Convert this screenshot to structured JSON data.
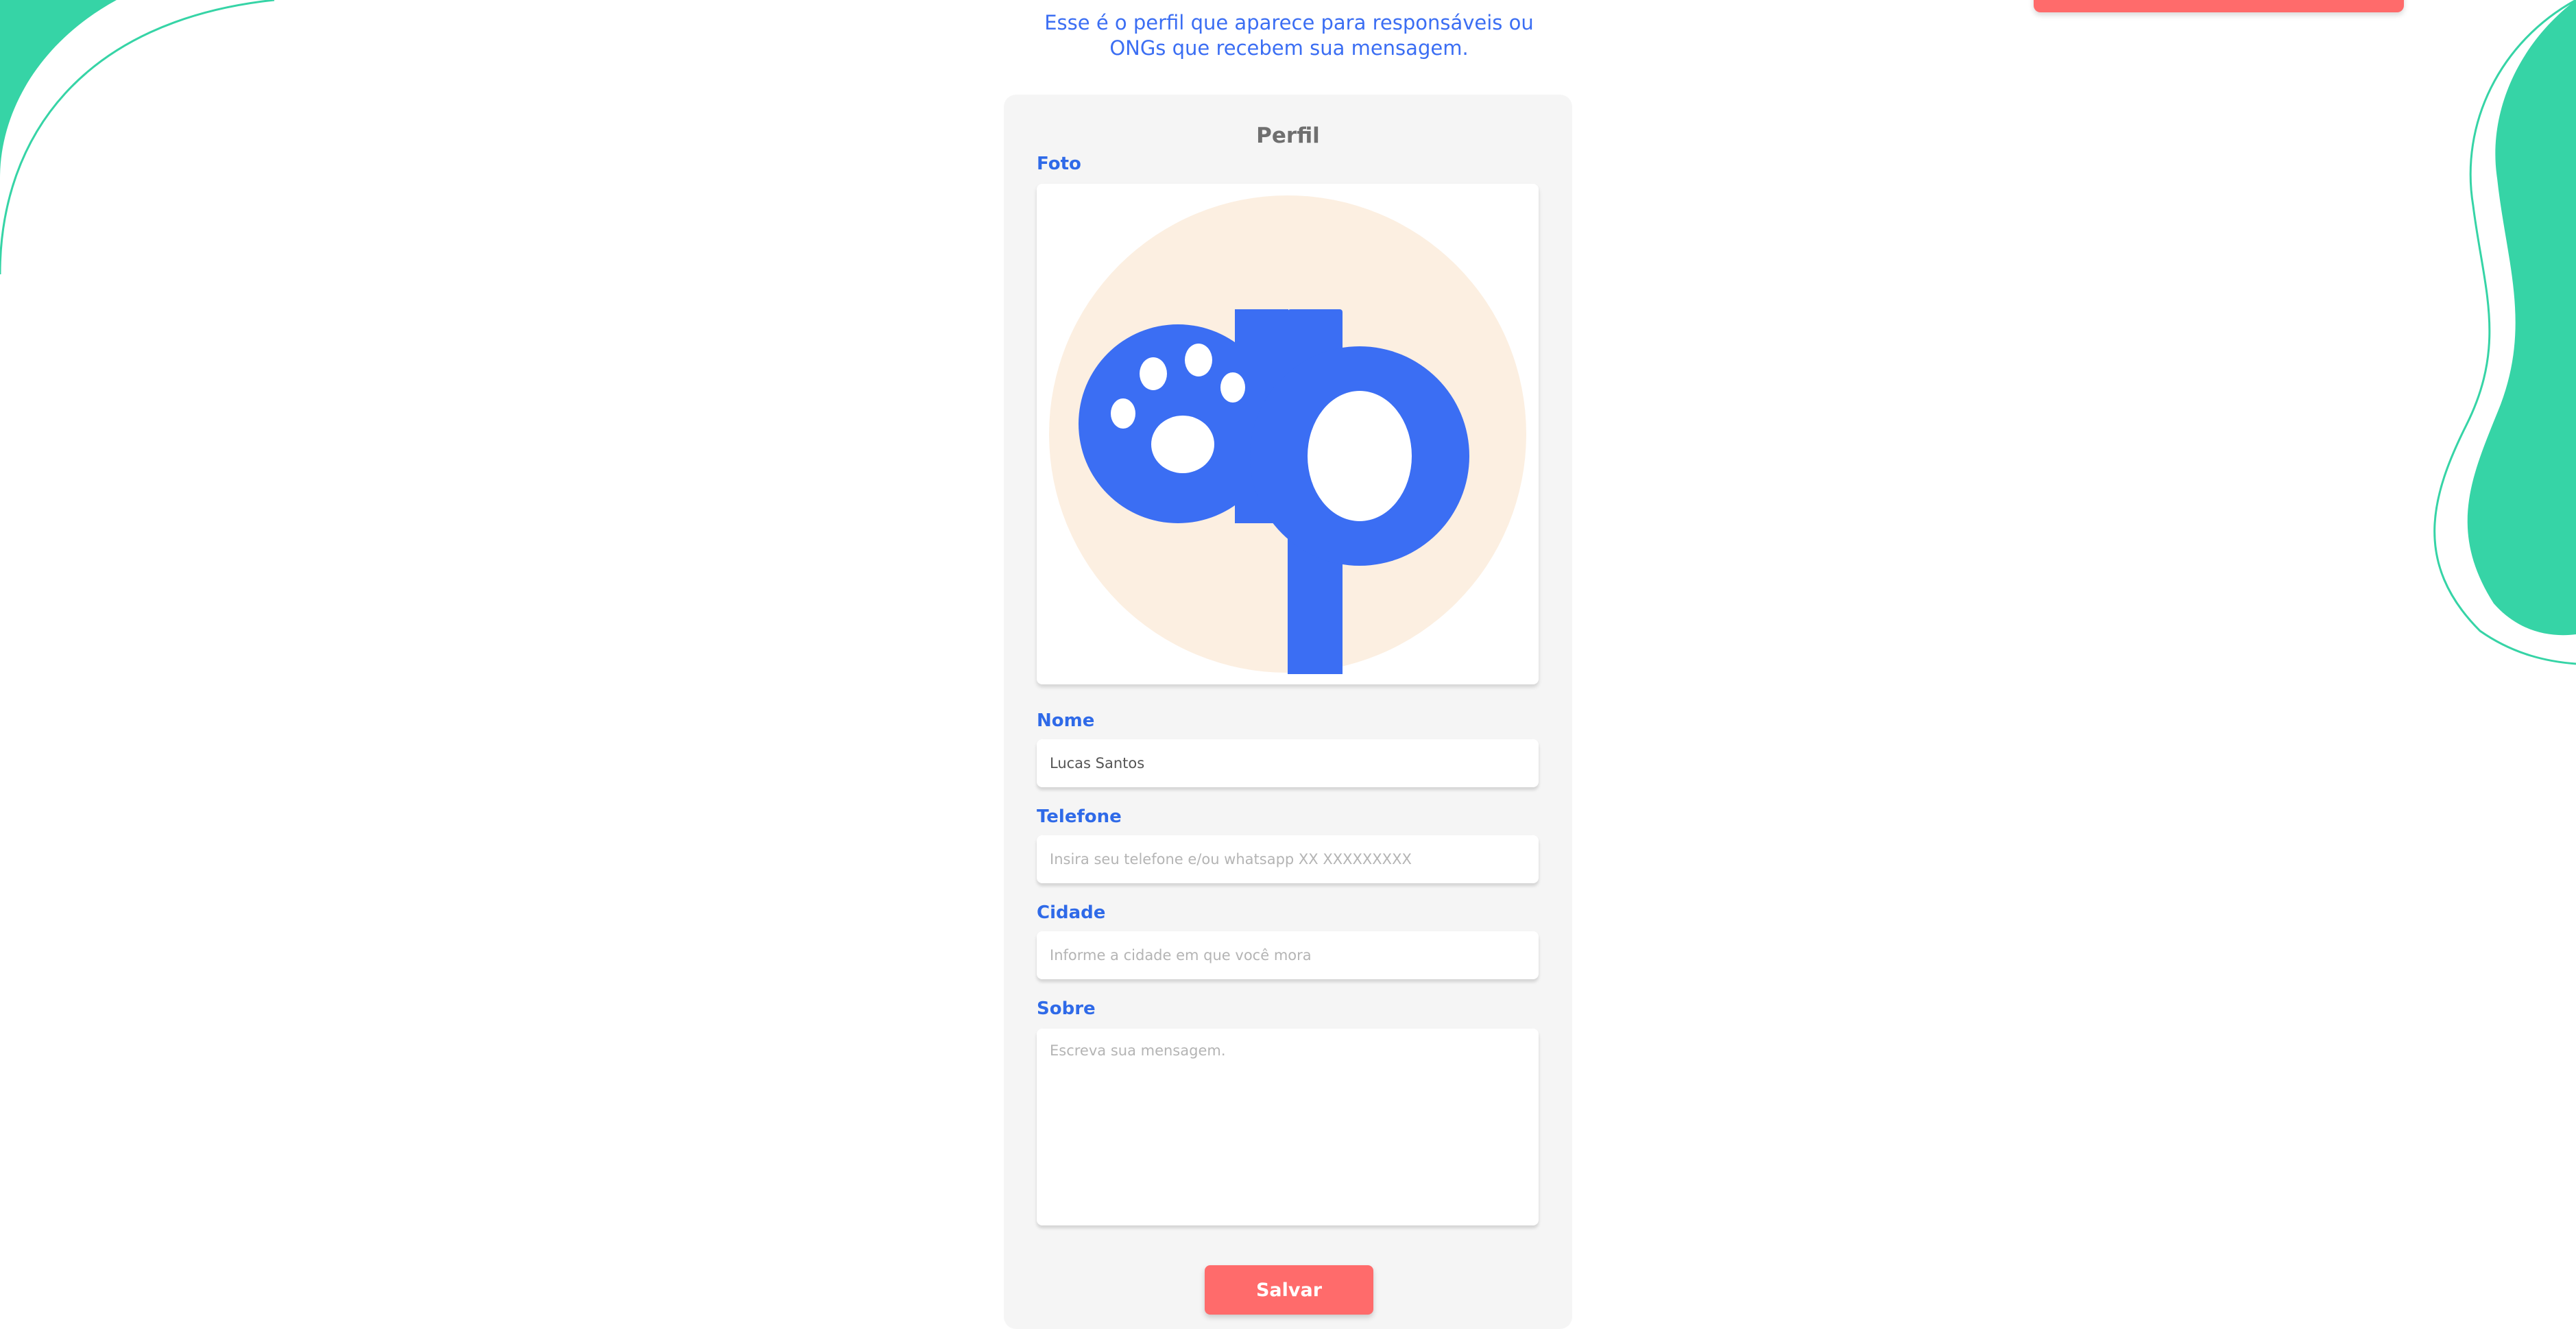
{
  "header": {
    "subtitle": "Esse é o perfil que aparece para responsáveis ou ONGs que recebem sua mensagem."
  },
  "profile": {
    "title": "Perfil",
    "photo_label": "Foto",
    "name": {
      "label": "Nome",
      "value": "Lucas Santos",
      "placeholder": ""
    },
    "phone": {
      "label": "Telefone",
      "value": "",
      "placeholder": "Insira seu telefone e/ou whatsapp XX XXXXXXXXX"
    },
    "city": {
      "label": "Cidade",
      "value": "",
      "placeholder": "Informe a cidade em que você mora"
    },
    "about": {
      "label": "Sobre",
      "value": "",
      "placeholder": "Escreva sua mensagem."
    },
    "save_label": "Salvar"
  },
  "logo": {
    "icon": "paw-icon",
    "letters": "ap"
  },
  "colors": {
    "accent_blue": "#3b6ef3",
    "button_red": "#ff6b6b",
    "decor_green": "#36d4a6",
    "card_bg": "#f5f5f5",
    "logo_bg": "#fcefe1"
  }
}
